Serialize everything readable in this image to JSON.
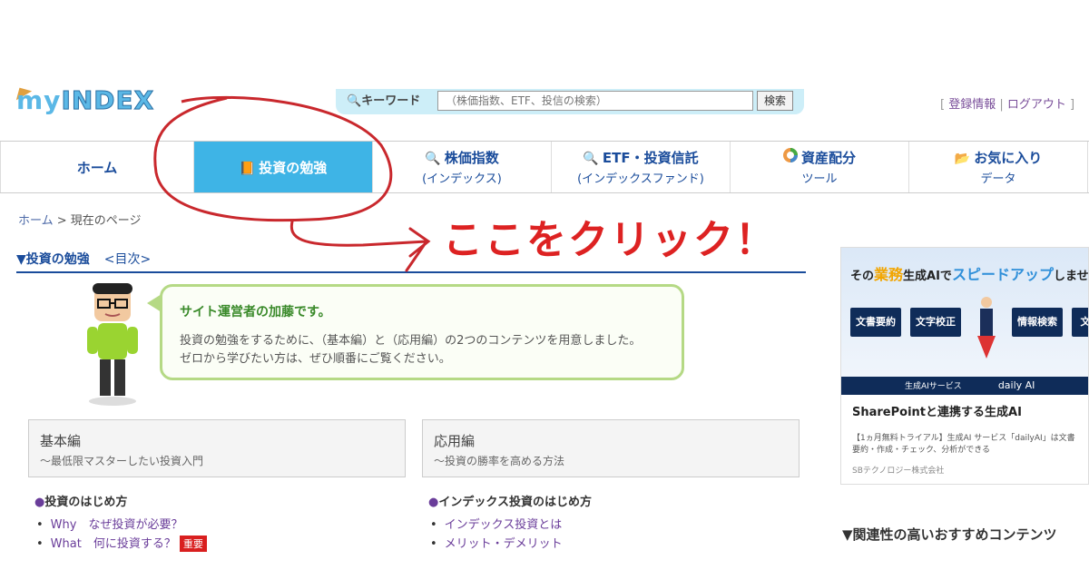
{
  "header": {
    "logo_my": "my",
    "logo_index": "INDEX",
    "search_label": "キーワード",
    "search_placeholder": "（株価指数、ETF、投信の検索）",
    "search_button": "検索",
    "account_links": [
      "登録情報",
      "ログアウト"
    ]
  },
  "nav": {
    "items": [
      {
        "main": "ホーム",
        "sub": "",
        "icon": ""
      },
      {
        "main": "投資の勉強",
        "sub": "",
        "icon": "book-icon"
      },
      {
        "main": "株価指数",
        "sub": "(インデックス)",
        "icon": "magnifier-icon"
      },
      {
        "main": "ETF・投資信託",
        "sub": "(インデックスファンド)",
        "icon": "magnifier-icon"
      },
      {
        "main": "資産配分",
        "sub": "ツール",
        "icon": "pie-icon"
      },
      {
        "main": "お気に入り",
        "sub": "データ",
        "icon": "folder-icon"
      }
    ]
  },
  "breadcrumb": {
    "home": "ホーム",
    "current": " > 現在のページ"
  },
  "section": {
    "heading": "▼投資の勉強",
    "toc": "<目次>"
  },
  "bubble": {
    "title": "サイト運営者の加藤です。",
    "line1": "投資の勉強をするために、（基本編）と（応用編）の2つのコンテンツを用意しました。",
    "line2": "ゼロから学びたい方は、ぜひ順番にご覧ください。"
  },
  "boxes": {
    "basic": {
      "title": "基本編",
      "sub": "～最低限マスターしたい投資入門"
    },
    "adv": {
      "title": "応用編",
      "sub": "～投資の勝率を高める方法"
    }
  },
  "lists": {
    "basic": {
      "heading": "投資のはじめ方",
      "items": [
        "Why　なぜ投資が必要？",
        "What　何に投資する？"
      ],
      "badge": "重要"
    },
    "adv": {
      "heading": "インデックス投資のはじめ方",
      "items": [
        "インデックス投資とは",
        "メリット・デメリット"
      ]
    }
  },
  "annotation": {
    "text": "ここをクリック！",
    "color": "#dd2222"
  },
  "ad": {
    "head_pre": "その",
    "head_y": "業務",
    "head_mid": "生成AIで",
    "head_b": "スピードアップ",
    "head_post": "しませ",
    "chips": [
      "文書要約",
      "文字校正",
      "情報検索",
      "文"
    ],
    "band_left": "生成AIサービス",
    "band_right": "daily AI",
    "title": "SharePointと連携する生成AI",
    "desc": "【1ヵ月無料トライアル】生成AI サービス「dailyAI」は文書要約・作成・チェック、分析ができる",
    "source": "SBテクノロジー株式会社"
  },
  "recommend_heading": "▼関連性の高いおすすめコンテンツ"
}
